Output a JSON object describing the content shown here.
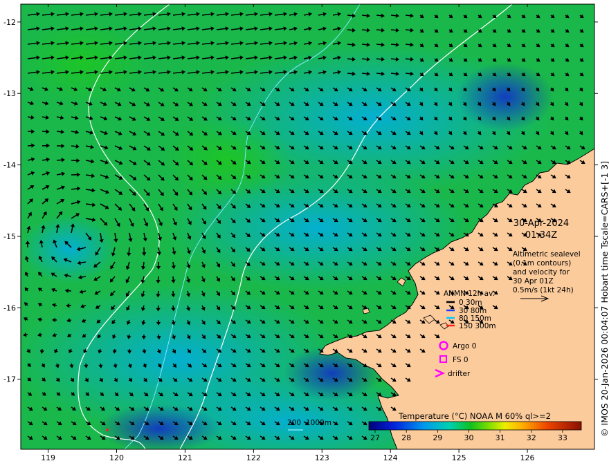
{
  "map": {
    "date": "30-Apr-2024",
    "time": "01:34Z",
    "altimetry_lines": [
      "Altimetric sealevel",
      "(0.1m contours)",
      "and velocity for",
      "30 Apr 01Z",
      "0.5m/s (1kt 24h)"
    ],
    "anmn_title": "ANMN 12h av.",
    "anmn_legend": [
      {
        "label": "0 30m",
        "color": "#000000"
      },
      {
        "label": "30 80m",
        "color": "#1e3cff"
      },
      {
        "label": "80 150m",
        "color": "#00c8ff"
      },
      {
        "label": "150 300m",
        "color": "#ff2020"
      }
    ],
    "argo_label": "Argo 0",
    "fs_label": "FS 0",
    "drifter_label": "drifter",
    "marker_color": "#ff00ff",
    "contour_label_200": "200",
    "contour_label_1000": "1000m",
    "contour_200_color": "#7fe8ff",
    "contour_1000_color": "#ffffff",
    "colorbar_title": "Temperature (°C) NOAA  M 60% ql>=2",
    "colorbar_ticks": [
      "27",
      "28",
      "29",
      "30",
      "31",
      "32",
      "33"
    ],
    "colorbar_range": [
      26.8,
      33.6
    ],
    "credit": "© IMOS 20-Jan-2026 00:04:07 Hobart time Tscale=CARS+[-1 3]",
    "land_color": "#fbcb9c",
    "lon_ticks": [
      "119",
      "120",
      "121",
      "122",
      "123",
      "124",
      "125",
      "126"
    ],
    "lat_ticks": [
      "-12",
      "-13",
      "-14",
      "-15",
      "-16",
      "-17"
    ],
    "lon_range": [
      118.6,
      126.98
    ],
    "lat_range": [
      -11.75,
      -17.98
    ]
  }
}
